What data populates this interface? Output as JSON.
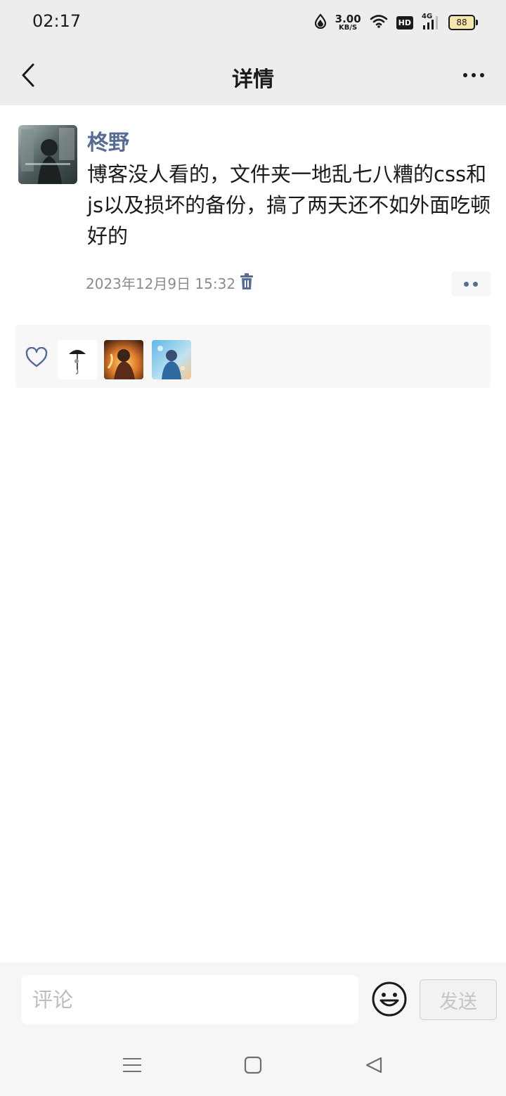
{
  "status_bar": {
    "time": "02:17",
    "net_speed_value": "3.00",
    "net_speed_unit": "KB/S",
    "hd_label": "HD",
    "signal_label": "4G",
    "battery": "88"
  },
  "header": {
    "title": "详情",
    "back_icon": "chevron-left-icon",
    "more_icon": "more-dots-icon"
  },
  "post": {
    "author": "柊野",
    "content": "博客没人看的，文件夹一地乱七八糟的css和js以及损坏的备份，搞了两天还不如外面吃顿好的",
    "timestamp": "2023年12月9日 15:32",
    "delete_icon": "trash-icon",
    "action_icon": "two-dots-icon"
  },
  "likes": {
    "icon": "heart-outline-icon",
    "liker_count": 3
  },
  "comment_bar": {
    "placeholder": "评论",
    "emoji_icon": "smiley-icon",
    "send_label": "发送"
  },
  "nav": {
    "menu_icon": "menu-icon",
    "home_icon": "square-icon",
    "back_icon": "triangle-back-icon"
  },
  "colors": {
    "link_blue": "#576b95",
    "header_bg": "#ededed",
    "muted_text": "#8c8c8c"
  }
}
